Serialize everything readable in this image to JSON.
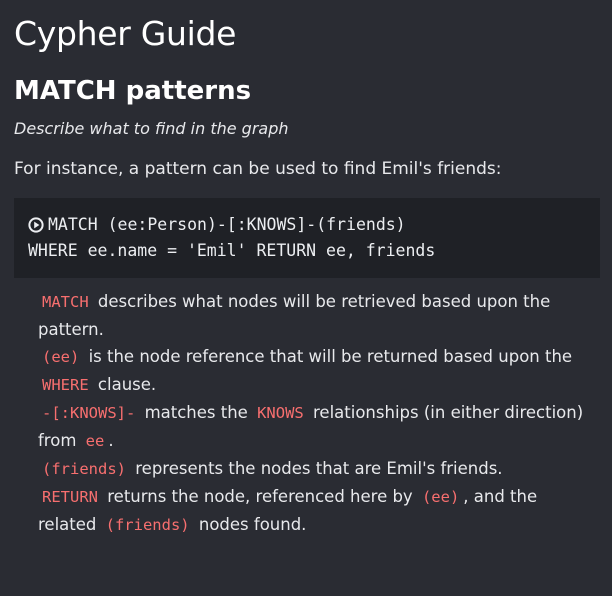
{
  "guide": {
    "title": "Cypher Guide",
    "section_title": "MATCH patterns",
    "section_subtitle": "Describe what to find in the graph",
    "intro": "For instance, a pattern can be used to find Emil's friends:",
    "code": {
      "run_icon": "play-circle-icon",
      "line1": "MATCH (ee:Person)-[:KNOWS]-(friends)",
      "line2": "WHERE ee.name = 'Emil' RETURN ee, friends"
    },
    "notes": [
      {
        "code": "MATCH",
        "text": "describes what nodes will be retrieved based upon the pattern."
      },
      {
        "code": "(ee)",
        "text": "is the node reference that will be returned based upon the",
        "code2": "WHERE",
        "text2": "clause."
      },
      {
        "code": "-[:KNOWS]-",
        "text": "matches the",
        "code2": "KNOWS",
        "text2": "relationships (in either direction) from",
        "code3": "ee",
        "text3": "."
      },
      {
        "code": "(friends)",
        "text": "represents the nodes that are Emil's friends."
      },
      {
        "code": "RETURN",
        "text": "returns the node, referenced here by",
        "code2": "(ee)",
        "text2": ", and the related",
        "code3": "(friends)",
        "text3": "nodes found."
      }
    ],
    "colors": {
      "background": "#2a2c33",
      "code_background": "#1f2126",
      "keyword": "#f76f6f"
    }
  }
}
